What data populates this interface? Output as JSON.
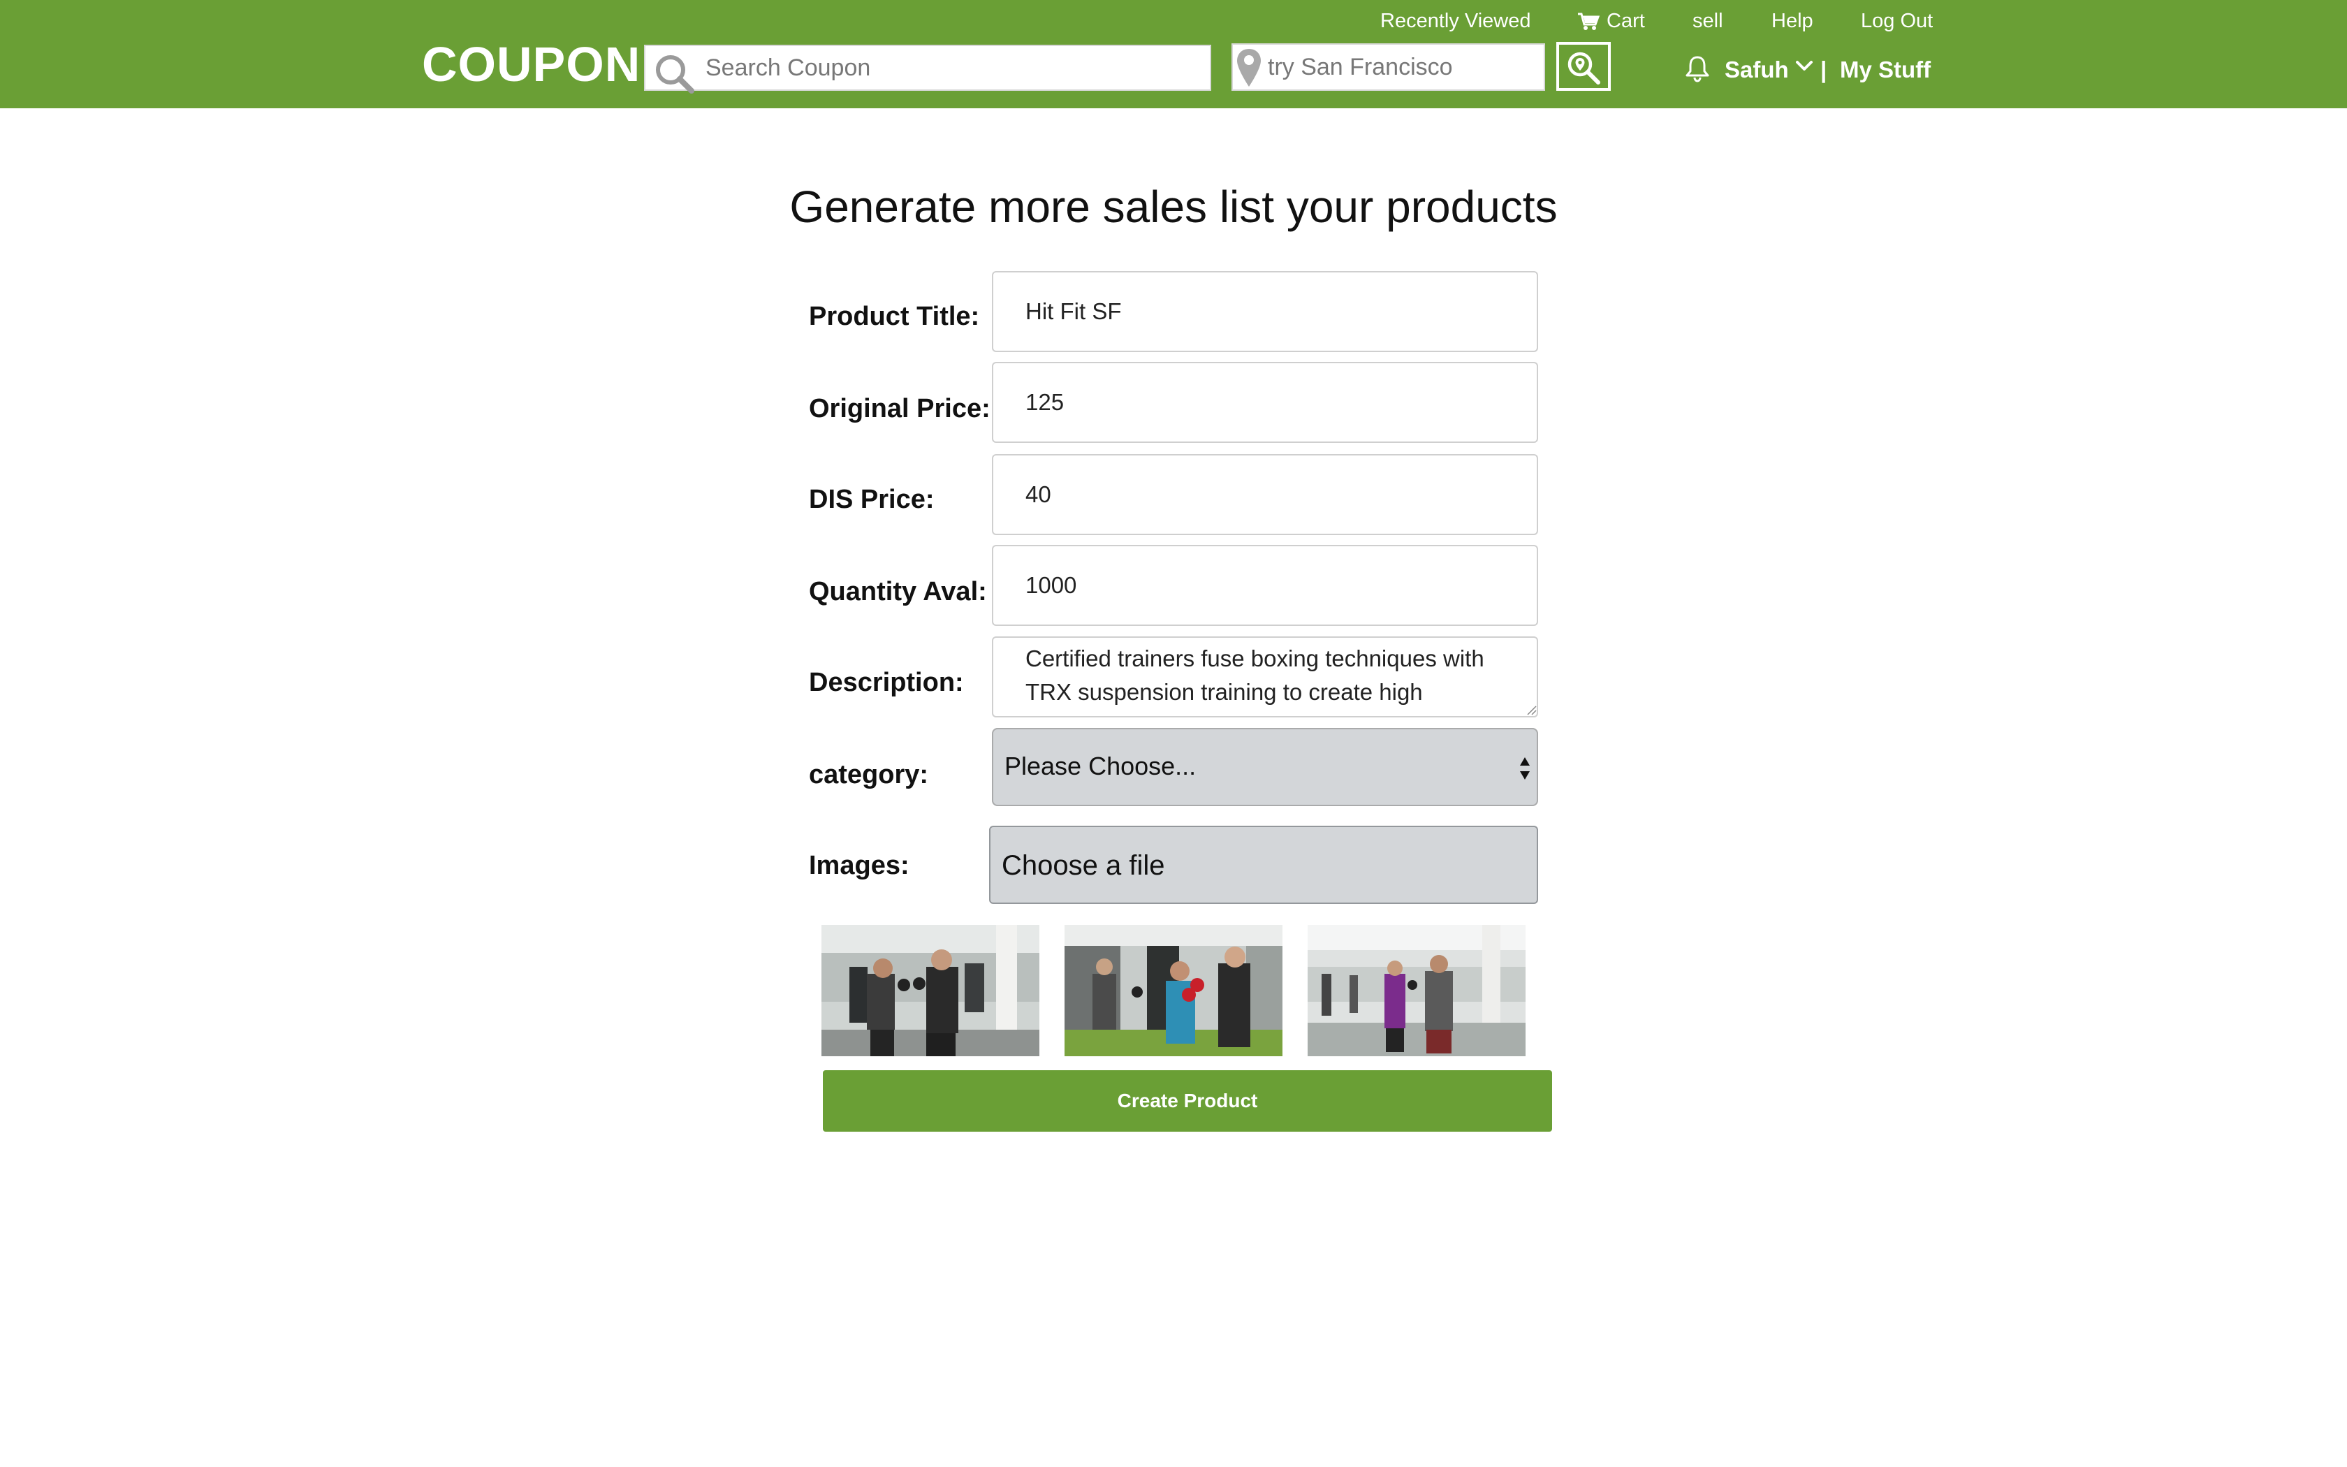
{
  "header": {
    "logo": "COUPON",
    "links": {
      "recently_viewed": "Recently Viewed",
      "cart": "Cart",
      "sell": "sell",
      "help": "Help",
      "logout": "Log Out"
    },
    "search_placeholder": "Search Coupon",
    "location_placeholder": "try San Francisco",
    "user_name": "Safuh",
    "separator": "|",
    "my_stuff": "My Stuff"
  },
  "page": {
    "title": "Generate more sales list your products"
  },
  "form": {
    "product_title": {
      "label": "Product Title:",
      "value": "Hit Fit SF"
    },
    "original_price": {
      "label": "Original Price:",
      "value": "125"
    },
    "dis_price": {
      "label": "DIS Price:",
      "value": "40"
    },
    "quantity": {
      "label": "Quantity Aval:",
      "value": "1000"
    },
    "description": {
      "label": "Description:",
      "value": "Certified trainers fuse boxing techniques with TRX suspension training to create high intensity workouts"
    },
    "category": {
      "label": "category:",
      "selected": "Please Choose..."
    },
    "images": {
      "label": "Images:",
      "button": "Choose a file"
    },
    "submit": "Create Product"
  },
  "colors": {
    "brand_green": "#6a9f35",
    "field_gray": "#d3d6d9"
  },
  "icons": [
    "search-icon",
    "cart-icon",
    "location-pin-icon",
    "search-location-icon",
    "bell-icon",
    "chevron-down-icon",
    "select-arrows-icon",
    "resize-grip-icon"
  ]
}
